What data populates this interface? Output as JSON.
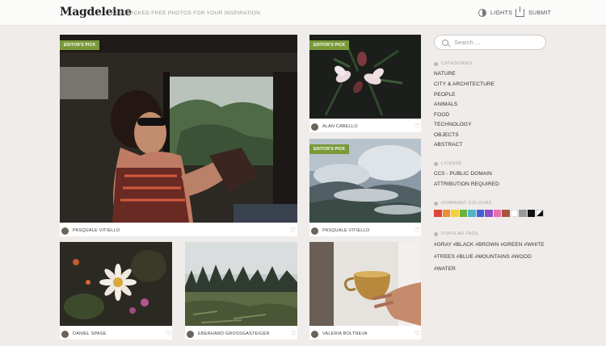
{
  "header": {
    "logo": "Magdeleine",
    "tagline": "HAND-PICKED FREE PHOTOS FOR YOUR INSPIRATION",
    "lights_label": "LIGHTS",
    "submit_label": "SUBMIT"
  },
  "photos": [
    {
      "author": "PASQUALE VITIELLO",
      "badge": "EDITOR'S PICK"
    },
    {
      "author": "ALAN CABELLO",
      "badge": "EDITOR'S PICK"
    },
    {
      "author": "PASQUALE VITIELLO",
      "badge": "EDITOR'S PICK"
    },
    {
      "author": "DANIEL SPASE",
      "badge": ""
    },
    {
      "author": "EBERHARD GROSSGASTEIGER",
      "badge": ""
    },
    {
      "author": "VALERIA BOLTNEVA",
      "badge": ""
    }
  ],
  "sidebar": {
    "search_placeholder": "Search ...",
    "categories_title": "CATEGORIES",
    "categories": [
      "NATURE",
      "CITY & ARCHITECTURE",
      "PEOPLE",
      "ANIMALS",
      "FOOD",
      "TECHNOLOGY",
      "OBJECTS",
      "ABSTRACT"
    ],
    "license_title": "LICENSE",
    "licenses": [
      "CC0 - PUBLIC DOMAIN",
      "ATTRIBUTION REQUIRED"
    ],
    "colours_title": "DOMINANT COLOURS",
    "colours": [
      "#e0473c",
      "#ec8f32",
      "#f1d13c",
      "#6cb23f",
      "#4fb6c9",
      "#3f63d6",
      "#8a4fc9",
      "#e86fae",
      "#a9523c",
      "#ffffff",
      "#9a9a9a",
      "#111111",
      "#bw"
    ],
    "tags_title": "POPULAR TAGS",
    "tags_lines": [
      "#GRAY  #BLACK  #BROWN  #GREEN  #WHITE",
      "#TREES  #BLUE  #MOUNTAINS  #WOOD",
      "#WATER"
    ]
  }
}
